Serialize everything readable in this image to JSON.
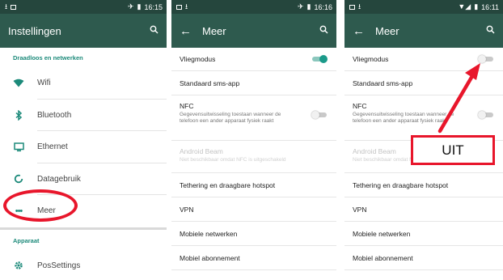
{
  "screens": {
    "settings": {
      "status_time": "16:15",
      "title": "Instellingen",
      "section1": "Draadloos en netwerken",
      "items": [
        {
          "label": "Wifi",
          "icon": "wifi-icon"
        },
        {
          "label": "Bluetooth",
          "icon": "bluetooth-icon"
        },
        {
          "label": "Ethernet",
          "icon": "ethernet-icon"
        },
        {
          "label": "Datagebruik",
          "icon": "data-usage-icon"
        },
        {
          "label": "Meer",
          "icon": "more-icon"
        }
      ],
      "section2": "Apparaat",
      "items2": [
        {
          "label": "PosSettings",
          "icon": "gear-icon"
        }
      ]
    },
    "more_on": {
      "status_time": "16:16",
      "title": "Meer",
      "airplane_label": "Vliegmodus",
      "airplane_on": true,
      "sms_label": "Standaard sms-app",
      "nfc_label": "NFC",
      "nfc_sub": "Gegevensuitwisseling toestaan wanneer de telefoon een ander apparaat fysiek raakt",
      "beam_label": "Android Beam",
      "beam_sub": "Niet beschikbaar omdat NFC is uitgeschakeld",
      "tethering_label": "Tethering en draagbare hotspot",
      "vpn_label": "VPN",
      "mobile_networks_label": "Mobiele netwerken",
      "mobile_sub_label": "Mobiel abonnement"
    },
    "more_off": {
      "status_time": "16:11",
      "title": "Meer",
      "airplane_label": "Vliegmodus",
      "airplane_on": false,
      "sms_label": "Standaard sms-app",
      "nfc_label": "NFC",
      "nfc_sub": "Gegevensuitwisseling toestaan wanneer de telefoon een ander apparaat fysiek raakt",
      "beam_label": "Android Beam",
      "beam_sub": "Niet beschikbaar omdat NFC is uitgeschakeld",
      "tethering_label": "Tethering en draagbare hotspot",
      "vpn_label": "VPN",
      "mobile_networks_label": "Mobiele netwerken",
      "mobile_sub_label": "Mobiel abonnement"
    }
  },
  "annotation": {
    "uit_label": "UIT",
    "color": "#e8162b"
  },
  "colors": {
    "appbar": "#2e5a4e",
    "statusbar": "#25463d",
    "accent": "#1c8a7a"
  }
}
